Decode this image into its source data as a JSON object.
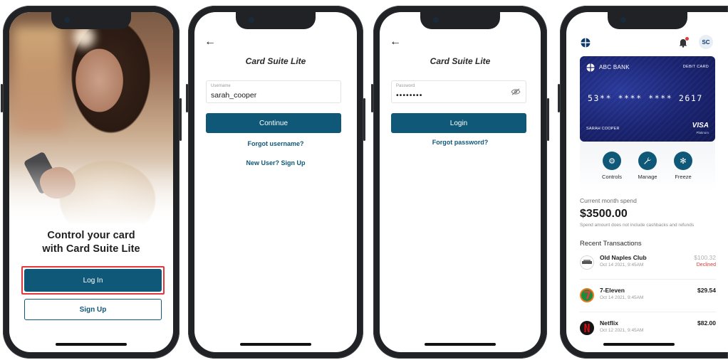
{
  "screen1": {
    "tagline_line1": "Control your card",
    "tagline_line2": "with Card Suite Lite",
    "login_label": "Log In",
    "signup_label": "Sign Up"
  },
  "screen2": {
    "title": "Card Suite Lite",
    "username_label": "Username",
    "username_value": "sarah_cooper",
    "continue_label": "Continue",
    "forgot_username": "Forgot username?",
    "new_user": "New User? Sign Up"
  },
  "screen3": {
    "title": "Card Suite Lite",
    "password_label": "Password",
    "password_value": "••••••••",
    "login_label": "Login",
    "forgot_password": "Forgot password?"
  },
  "screen4": {
    "avatar_initials": "SC",
    "card": {
      "bank_name": "ABC BANK",
      "card_type": "DEBIT CARD",
      "number": "53** **** **** 2617",
      "holder": "SARAH COOPER",
      "network": "VISA",
      "tier": "Platinum",
      "color": "#1a2370"
    },
    "actions": [
      {
        "label": "Controls",
        "icon": "gear-icon"
      },
      {
        "label": "Manage",
        "icon": "wrench-icon"
      },
      {
        "label": "Freeze",
        "icon": "snowflake-icon"
      }
    ],
    "current_month_label": "Current month spend",
    "current_month_amount": "$3500.00",
    "spend_note": "Spend amount does not include cashbacks and refunds",
    "recent_label": "Recent Transactions",
    "transactions": [
      {
        "name": "Old Naples Club",
        "date": "Oct 14 2021, 9:45AM",
        "amount": "$100.32",
        "status": "Declined"
      },
      {
        "name": "7-Eleven",
        "date": "Oct 14 2021, 9:45AM",
        "amount": "$29.54",
        "status": ""
      },
      {
        "name": "Netflix",
        "date": "Oct 12 2021, 9:45AM",
        "amount": "$82.00",
        "status": ""
      }
    ]
  },
  "colors": {
    "primary": "#0f5878",
    "highlight": "#e4363c",
    "declined": "#d23b3b"
  }
}
